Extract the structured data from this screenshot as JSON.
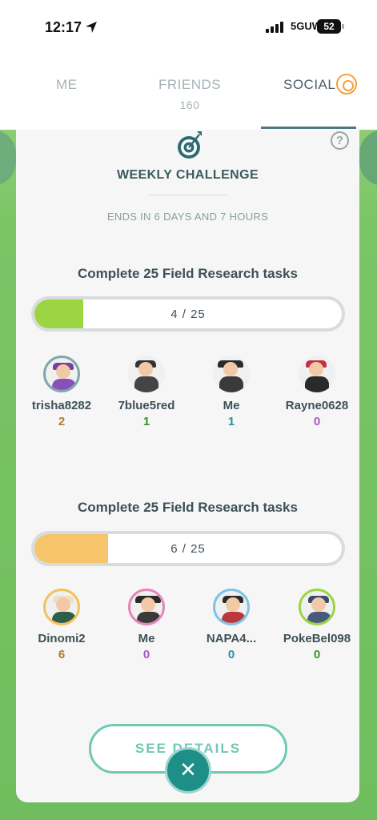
{
  "status_bar": {
    "time": "12:17",
    "network": "5GUW",
    "battery": "52"
  },
  "tabs": [
    {
      "label": "ME"
    },
    {
      "label": "FRIENDS",
      "sub": "160"
    },
    {
      "label": "SOCIAL"
    }
  ],
  "challenge": {
    "title": "WEEKLY CHALLENGE",
    "ends": "ENDS IN 6 DAYS AND 7 HOURS"
  },
  "groups": [
    {
      "task": "Complete 25 Field Research tasks",
      "progress_text": "4 / 25",
      "progress_value": 4,
      "progress_total": 25,
      "fill_color": "#9bd642",
      "members": [
        {
          "name": "trisha8282",
          "score": "2",
          "score_color": "#b07c2a",
          "ring": "#7fa7ad"
        },
        {
          "name": "7blue5red",
          "score": "1",
          "score_color": "#3f8f2e",
          "ring": ""
        },
        {
          "name": "Me",
          "score": "1",
          "score_color": "#2d8ea8",
          "ring": ""
        },
        {
          "name": "Rayne0628",
          "score": "0",
          "score_color": "#a35bc2",
          "ring": ""
        }
      ]
    },
    {
      "task": "Complete 25 Field Research tasks",
      "progress_text": "6 / 25",
      "progress_value": 6,
      "progress_total": 25,
      "fill_color": "#f6c46a",
      "members": [
        {
          "name": "Dinomi2",
          "score": "6",
          "score_color": "#b07c2a",
          "ring": "#f4c25a"
        },
        {
          "name": "Me",
          "score": "0",
          "score_color": "#a35bc2",
          "ring": "#e486b8"
        },
        {
          "name": "NAPA4...",
          "score": "0",
          "score_color": "#2d8ea8",
          "ring": "#7ec4e6"
        },
        {
          "name": "PokeBel098",
          "score": "0",
          "score_color": "#3f8f2e",
          "ring": "#9bd642"
        }
      ]
    }
  ],
  "buttons": {
    "see_details": "SEE DETAILS",
    "close": "✕"
  }
}
